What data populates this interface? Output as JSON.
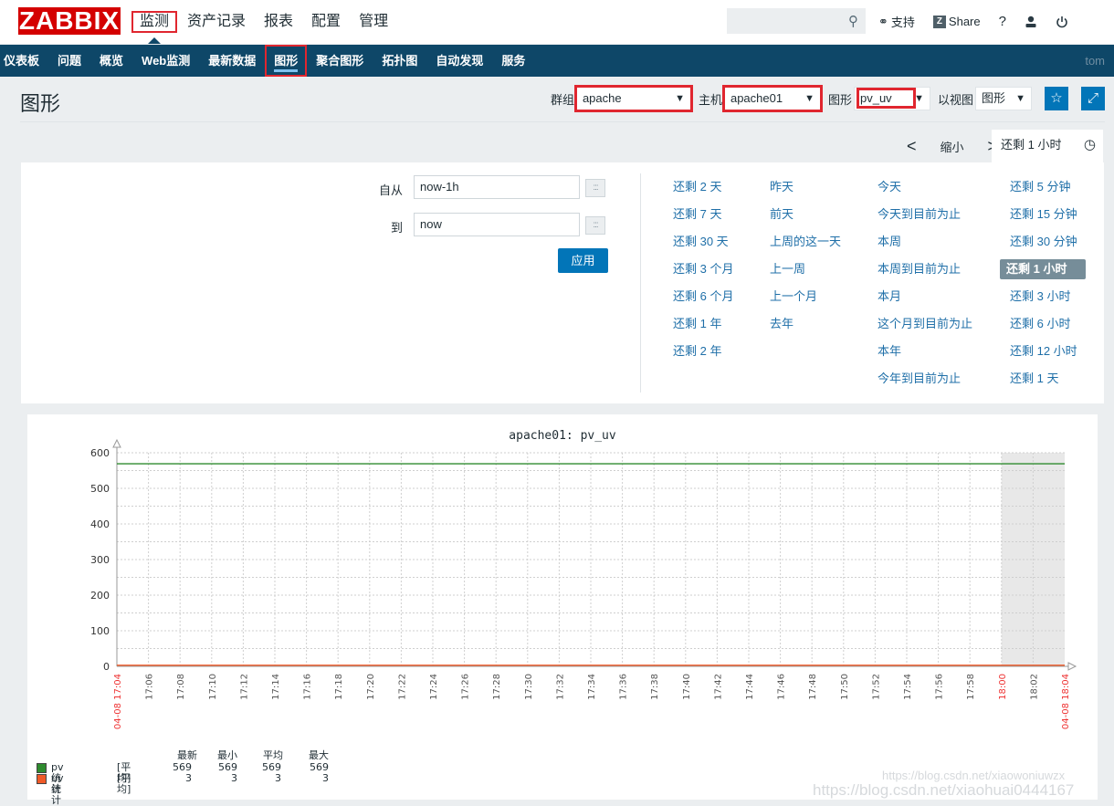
{
  "header": {
    "logo": "ZABBIX",
    "nav": [
      "监测",
      "资产记录",
      "报表",
      "配置",
      "管理"
    ],
    "active_nav": 0,
    "search_placeholder": "",
    "support": "支持",
    "share": "Share",
    "help": "?",
    "user_icon": "user-icon",
    "logout_icon": "power-icon"
  },
  "subnav": {
    "items": [
      "仪表板",
      "问题",
      "概览",
      "Web监测",
      "最新数据",
      "图形",
      "聚合图形",
      "拓扑图",
      "自动发现",
      "服务"
    ],
    "active": 5,
    "user": "tom"
  },
  "page": {
    "title": "图形",
    "filters": {
      "group_label": "群组",
      "group_value": "apache",
      "host_label": "主机",
      "host_value": "apache01",
      "graph_label": "图形",
      "graph_value": "pv_uv",
      "view_label": "以视图",
      "view_value": "图形"
    }
  },
  "time": {
    "prev": "<",
    "zoom_out": "缩小",
    "next": ">",
    "tab_label": "还剩 1 小时",
    "from_label": "自从",
    "from_value": "now-1h",
    "to_label": "到",
    "to_value": "now",
    "apply": "应用",
    "quick": [
      [
        "还剩 2 天",
        "还剩 7 天",
        "还剩 30 天",
        "还剩 3 个月",
        "还剩 6 个月",
        "还剩 1 年",
        "还剩 2 年"
      ],
      [
        "昨天",
        "前天",
        "上周的这一天",
        "上一周",
        "上一个月",
        "去年"
      ],
      [
        "今天",
        "今天到目前为止",
        "本周",
        "本周到目前为止",
        "本月",
        "这个月到目前为止",
        "本年",
        "今年到目前为止"
      ],
      [
        "还剩 5 分钟",
        "还剩 15 分钟",
        "还剩 30 分钟",
        "还剩 1 小时",
        "还剩 3 小时",
        "还剩 6 小时",
        "还剩 12 小时",
        "还剩 1 天"
      ]
    ],
    "quick_selected": "还剩 1 小时"
  },
  "chart_data": {
    "type": "line",
    "title": "apache01: pv_uv",
    "ylim": [
      0,
      600
    ],
    "yticks": [
      0,
      100,
      200,
      300,
      400,
      500,
      600
    ],
    "x_start_label": "04-08 17:04",
    "x_end_label": "04-08 18:04",
    "xticks": [
      "17:06",
      "17:08",
      "17:10",
      "17:12",
      "17:14",
      "17:16",
      "17:18",
      "17:20",
      "17:22",
      "17:24",
      "17:26",
      "17:28",
      "17:30",
      "17:32",
      "17:34",
      "17:36",
      "17:38",
      "17:40",
      "17:42",
      "17:44",
      "17:46",
      "17:48",
      "17:50",
      "17:52",
      "17:54",
      "17:56",
      "17:58",
      "18:00",
      "18:02"
    ],
    "highlight_ticks": [
      "18:00"
    ],
    "x_range_minutes": [
      0,
      60
    ],
    "no_data_region_minutes": [
      56,
      60
    ],
    "grid": true,
    "series": [
      {
        "name": "pv统计",
        "func": "[平均]",
        "color": "#2e8b2e",
        "value": 569,
        "last": 569,
        "min": 569,
        "avg": 569,
        "max": 569
      },
      {
        "name": "uv统计",
        "func": "[平均]",
        "color": "#f05a28",
        "value": 3,
        "last": 3,
        "min": 3,
        "avg": 3,
        "max": 3
      }
    ],
    "legend_headers": [
      "最新",
      "最小",
      "平均",
      "最大"
    ]
  },
  "watermark": [
    "https://blog.csdn.net/xiaowoniuwzx",
    "https://blog.csdn.net/xiaohuai0444167"
  ]
}
